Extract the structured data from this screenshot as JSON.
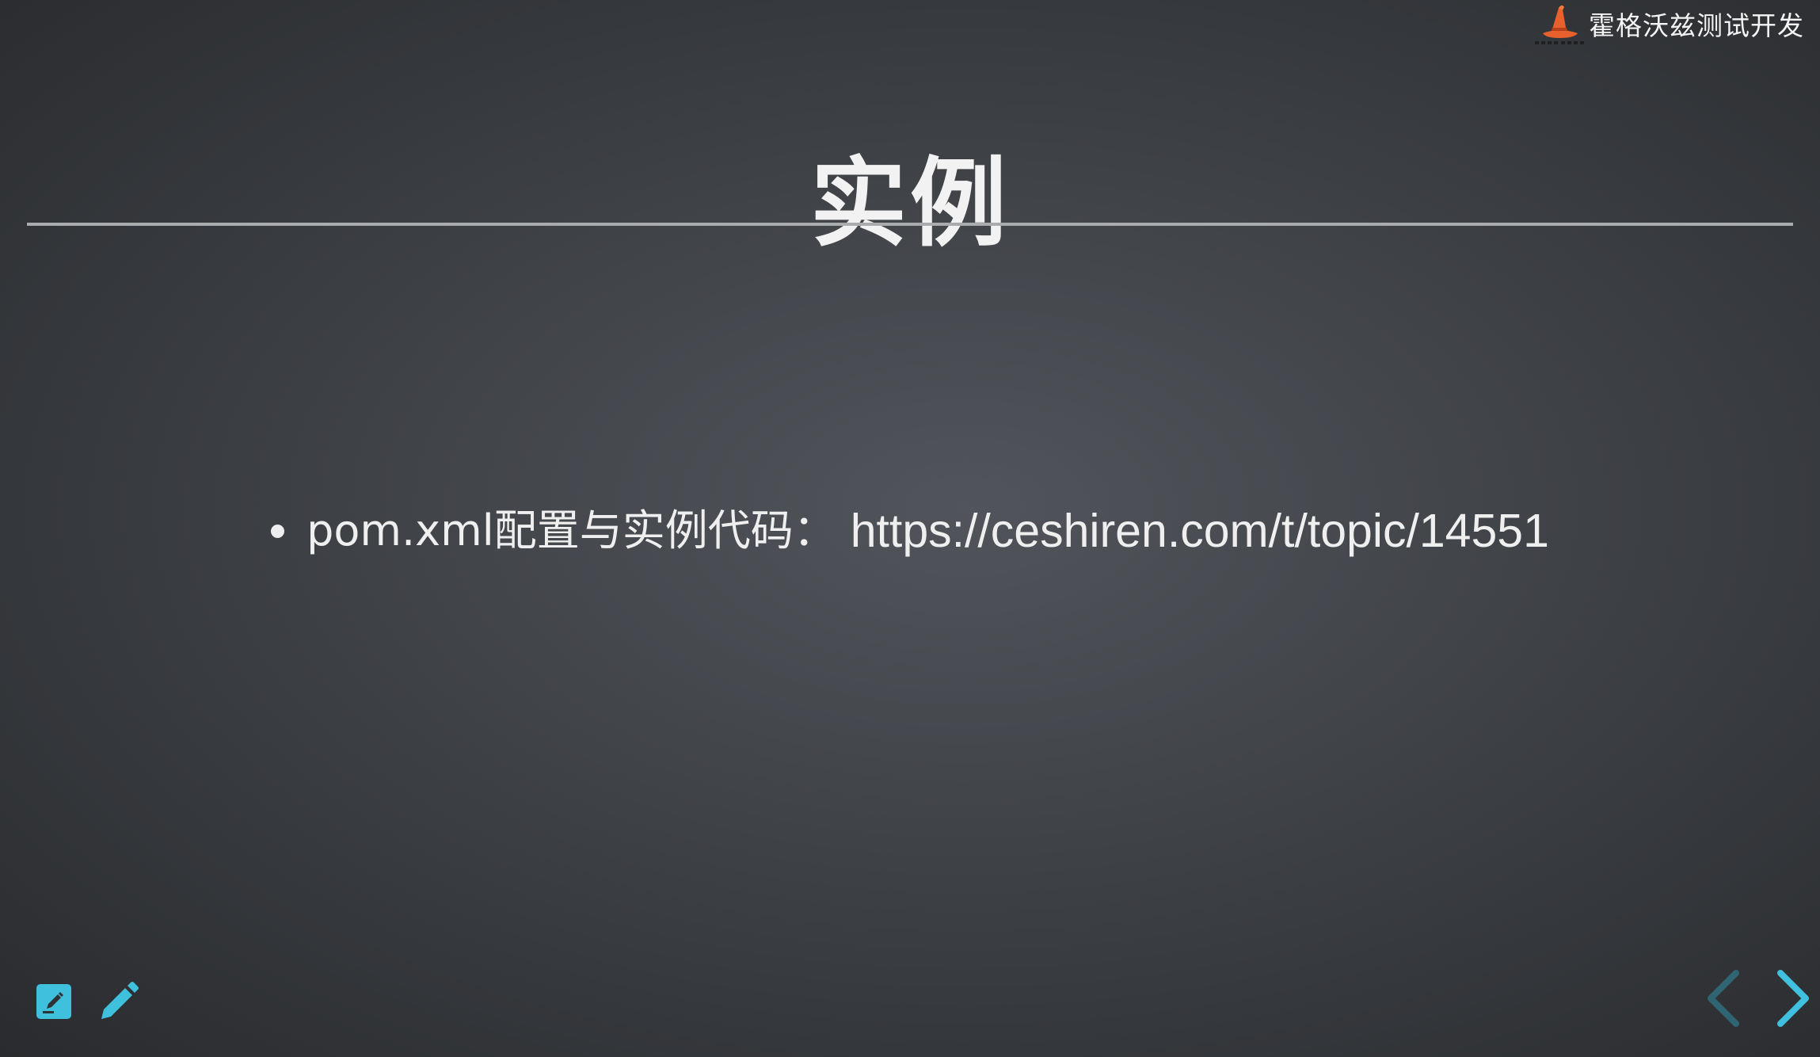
{
  "brand": {
    "name": "霍格沃兹测试开发",
    "logo": "wizard-hat-icon",
    "logo_color": "#e8602c"
  },
  "slide": {
    "title": "实例",
    "bullets": [
      {
        "text": "pom.xml配置与实例代码：",
        "link": "https://ceshiren.com/t/topic/14551"
      }
    ]
  },
  "toolbar": {
    "left_tools": [
      {
        "icon": "chalkboard-icon",
        "color": "#3fc1dd"
      },
      {
        "icon": "pen-icon",
        "color": "#3fc1dd"
      }
    ]
  },
  "navigation": {
    "prev_icon": "chevron-left-icon",
    "prev_enabled": false,
    "prev_color": "#2f6473",
    "next_icon": "chevron-right-icon",
    "next_enabled": true,
    "next_color": "#3fc1dd"
  },
  "colors": {
    "background": "#44474c",
    "text": "#efefef",
    "accent": "#3fc1dd"
  }
}
